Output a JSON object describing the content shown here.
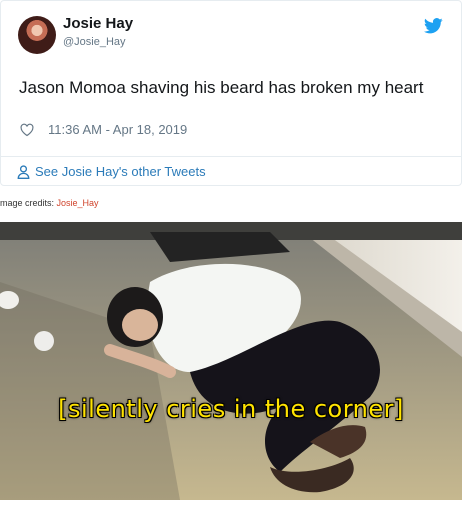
{
  "tweet": {
    "author_name": "Josie Hay",
    "author_handle": "@Josie_Hay",
    "text": "Jason Momoa shaving his beard has broken my heart",
    "timestamp": "11:36 AM - Apr 18, 2019",
    "other_tweets_link": "See Josie Hay's other Tweets"
  },
  "credits": {
    "label": "mage credits: ",
    "user": "Josie_Hay"
  },
  "meme": {
    "caption": "[silently cries in the corner]"
  },
  "colors": {
    "link": "#2b7bb9",
    "twitter_bird": "#1da1f2",
    "caption": "#ffe300",
    "credit_user": "#d0442c"
  },
  "icons": [
    "twitter-bird-icon",
    "heart-icon",
    "user-icon"
  ]
}
